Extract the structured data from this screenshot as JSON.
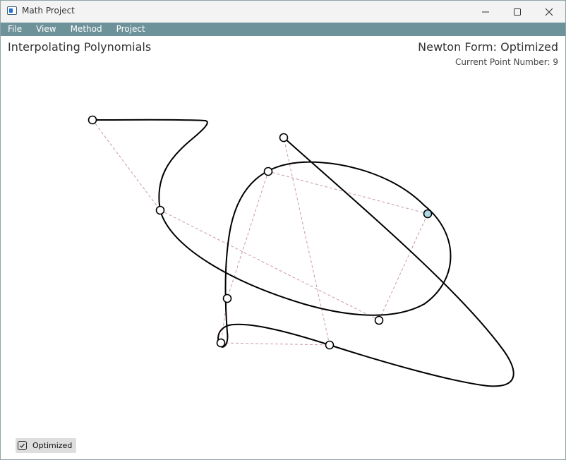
{
  "window": {
    "title": "Math Project",
    "minimize_glyph": "—",
    "maximize_glyph": "☐",
    "close_glyph": "✕"
  },
  "menu": [
    "File",
    "View",
    "Method",
    "Project"
  ],
  "header": {
    "title": "Interpolating Polynomials",
    "method": "Newton Form: Optimized",
    "point_label": "Current Point Number:",
    "point_number": "9"
  },
  "options": {
    "optimized_label": "Optimized",
    "optimized_checked": true
  },
  "colors": {
    "curve": "#000000",
    "guide": "#c89aa6",
    "selected_point": "#add8e6"
  }
}
